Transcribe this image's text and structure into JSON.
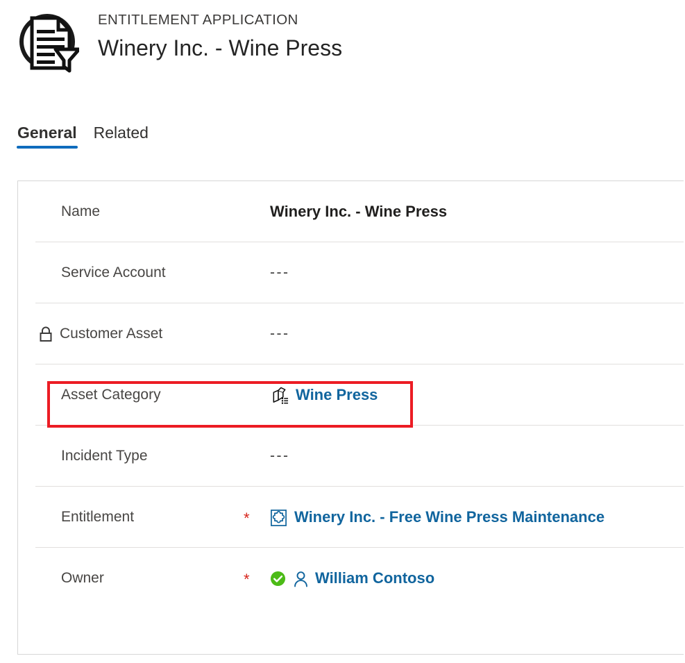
{
  "header": {
    "icon": "entitlement-application-document-funnel-icon",
    "eyebrow": "ENTITLEMENT APPLICATION",
    "title": "Winery Inc. - Wine Press"
  },
  "tabs": [
    {
      "label": "General",
      "active": true
    },
    {
      "label": "Related",
      "active": false
    }
  ],
  "form": {
    "rows": [
      {
        "label": "Name",
        "required": "",
        "value": "Winery Inc. - Wine Press",
        "value_kind": "strong",
        "lock": false,
        "icon": ""
      },
      {
        "label": "Service Account",
        "required": "",
        "value": "---",
        "value_kind": "empty",
        "lock": false,
        "icon": ""
      },
      {
        "label": "Customer Asset",
        "required": "",
        "value": "---",
        "value_kind": "empty",
        "lock": true,
        "lock_icon": "lock-icon",
        "icon": ""
      },
      {
        "label": "Asset Category",
        "required": "",
        "value": "Wine Press",
        "value_kind": "link",
        "lock": false,
        "icon": "product-box-list-icon",
        "highlighted": true
      },
      {
        "label": "Incident Type",
        "required": "",
        "value": "---",
        "value_kind": "empty",
        "lock": false,
        "icon": ""
      },
      {
        "label": "Entitlement",
        "required": "*",
        "value": "Winery Inc. - Free Wine Press Maintenance",
        "value_kind": "link",
        "lock": false,
        "icon": "entitlement-puzzle-square-icon"
      },
      {
        "label": "Owner",
        "required": "*",
        "value": "William Contoso",
        "value_kind": "link",
        "lock": false,
        "icon": "person-icon",
        "presence": "available-check-icon"
      }
    ]
  },
  "annotation": {
    "target": "Asset Category",
    "color": "#ec1c24"
  },
  "colors": {
    "link": "#11659e",
    "tab_accent": "#0f6cbd",
    "required_asterisk": "#d7241b",
    "presence_green": "#4cbb17",
    "divider": "#e1dfdd",
    "card_border": "#d6d6d6",
    "annotation_red": "#ec1c24"
  }
}
